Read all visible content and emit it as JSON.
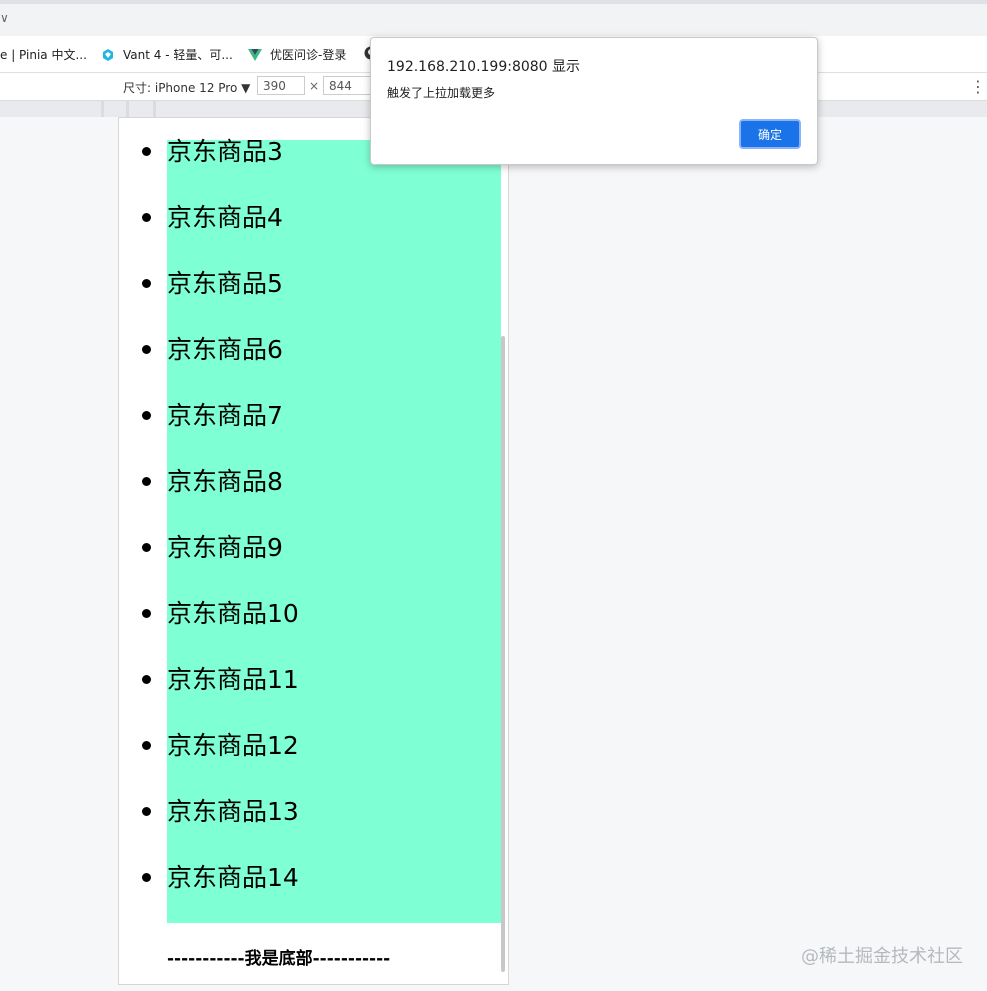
{
  "browser": {
    "tab_chevron": "∨",
    "bookmarks": [
      {
        "label": "e | Pinia 中文...",
        "icon": "pinia-icon"
      },
      {
        "label": "Vant 4 - 轻量、可...",
        "icon": "vant-logo-icon"
      },
      {
        "label": "优医问诊-登录",
        "icon": "vue-logo-icon"
      }
    ],
    "extra_bookmark_icon": "github-icon"
  },
  "devtools": {
    "device_label": "尺寸: iPhone 12 Pro ▼",
    "width": "390",
    "times": "×",
    "height": "844",
    "more": "⋮"
  },
  "page": {
    "items": [
      "京东商品3",
      "京东商品4",
      "京东商品5",
      "京东商品6",
      "京东商品7",
      "京东商品8",
      "京东商品9",
      "京东商品10",
      "京东商品11",
      "京东商品12",
      "京东商品13",
      "京东商品14"
    ],
    "footer": "-----------我是底部-----------",
    "list_bg": "#7fffd4"
  },
  "dialog": {
    "origin": "192.168.210.199:8080 显示",
    "message": "触发了上拉加载更多",
    "ok_label": "确定"
  },
  "watermark": "@稀土掘金技术社区"
}
